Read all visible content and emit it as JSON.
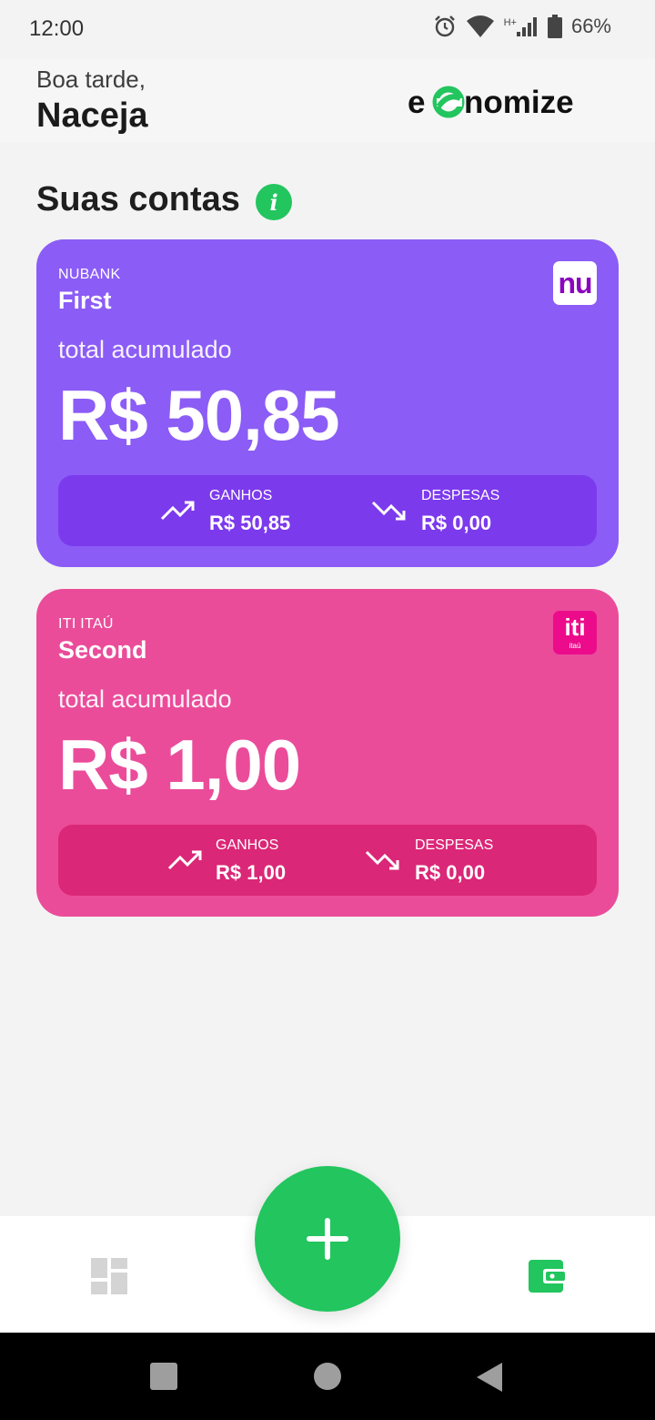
{
  "status_bar": {
    "time": "12:00",
    "network_label": "H+",
    "battery_percent": "66%"
  },
  "header": {
    "greeting": "Boa tarde,",
    "user_name": "Naceja",
    "logo_text": "economize"
  },
  "section": {
    "title": "Suas contas",
    "info_icon": "i"
  },
  "accounts": [
    {
      "bank": "NUBANK",
      "name": "First",
      "logo_text": "nu",
      "total_label": "total acumulado",
      "total": "R$ 50,85",
      "gains_label": "GANHOS",
      "gains": "R$ 50,85",
      "expenses_label": "DESPESAS",
      "expenses": "R$ 0,00",
      "color": "#8b5cf6"
    },
    {
      "bank": "ITI ITAÚ",
      "name": "Second",
      "logo_text": "iti",
      "logo_subtext": "itaú",
      "total_label": "total acumulado",
      "total": "R$ 1,00",
      "gains_label": "GANHOS",
      "gains": "R$ 1,00",
      "expenses_label": "DESPESAS",
      "expenses": "R$ 0,00",
      "color": "#ea4c9a"
    }
  ],
  "bottom_nav": {
    "items": [
      {
        "icon": "dashboard-icon",
        "active": false
      },
      {
        "icon": "add-icon",
        "active": false
      },
      {
        "icon": "wallet-icon",
        "active": true
      }
    ],
    "accent": "#22c55e"
  }
}
